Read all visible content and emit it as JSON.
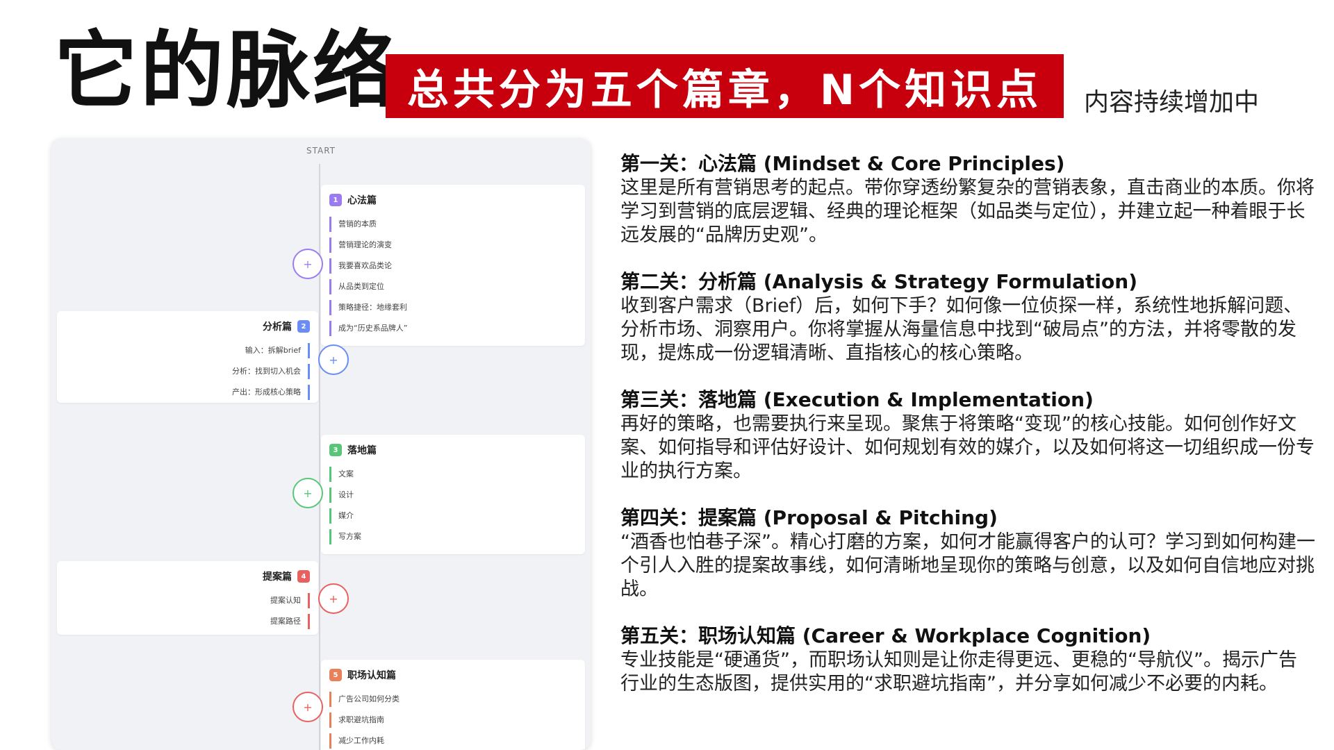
{
  "title": "它的脉络",
  "banner": "总共分为五个篇章，N个知识点",
  "aside": "内容持续增加中",
  "mindmap": {
    "start": "START",
    "nodes": [
      {
        "num": "1",
        "title": "心法篇",
        "color": "#9b7cf0",
        "items": [
          "营销的本质",
          "营销理论的演变",
          "我要喜欢品类论",
          "从品类到定位",
          "策略捷径：地缘套利",
          "成为“历史系品牌人”"
        ]
      },
      {
        "num": "2",
        "title": "分析篇",
        "color": "#6a8cf5",
        "items": [
          "输入：拆解brief",
          "分析：找到切入机会",
          "产出：形成核心策略"
        ]
      },
      {
        "num": "3",
        "title": "落地篇",
        "color": "#58c678",
        "items": [
          "文案",
          "设计",
          "媒介",
          "写方案"
        ]
      },
      {
        "num": "4",
        "title": "提案篇",
        "color": "#e86060",
        "items": [
          "提案认知",
          "提案路径"
        ]
      },
      {
        "num": "5",
        "title": "职场认知篇",
        "color": "#e8805a",
        "items": [
          "广告公司如何分类",
          "求职避坑指南",
          "减少工作内耗"
        ]
      }
    ]
  },
  "sections": [
    {
      "title": "第一关：心法篇 (Mindset & Core Principles)",
      "body": "这里是所有营销思考的起点。带你穿透纷繁复杂的营销表象，直击商业的本质。你将学习到营销的底层逻辑、经典的理论框架（如品类与定位），并建立起一种着眼于长远发展的“品牌历史观”。"
    },
    {
      "title": "第二关：分析篇 (Analysis & Strategy Formulation)",
      "body": "收到客户需求（Brief）后，如何下手？如何像一位侦探一样，系统性地拆解问题、分析市场、洞察用户。你将掌握从海量信息中找到“破局点”的方法，并将零散的发现，提炼成一份逻辑清晰、直指核心的核心策略。"
    },
    {
      "title": "第三关：落地篇 (Execution & Implementation)",
      "body": "再好的策略，也需要执行来呈现。聚焦于将策略“变现”的核心技能。如何创作好文案、如何指导和评估好设计、如何规划有效的媒介，以及如何将这一切组织成一份专业的执行方案。"
    },
    {
      "title": "第四关：提案篇 (Proposal & Pitching)",
      "body": "“酒香也怕巷子深”。精心打磨的方案，如何才能赢得客户的认可？学习到如何构建一个引人入胜的提案故事线，如何清晰地呈现你的策略与创意，以及如何自信地应对挑战。"
    },
    {
      "title": "第五关：职场认知篇 (Career & Workplace Cognition)",
      "body": "专业技能是“硬通货”，而职场认知则是让你走得更远、更稳的“导航仪”。揭示广告行业的生态版图，提供实用的“求职避坑指南”，并分享如何减少不必要的内耗。"
    }
  ]
}
